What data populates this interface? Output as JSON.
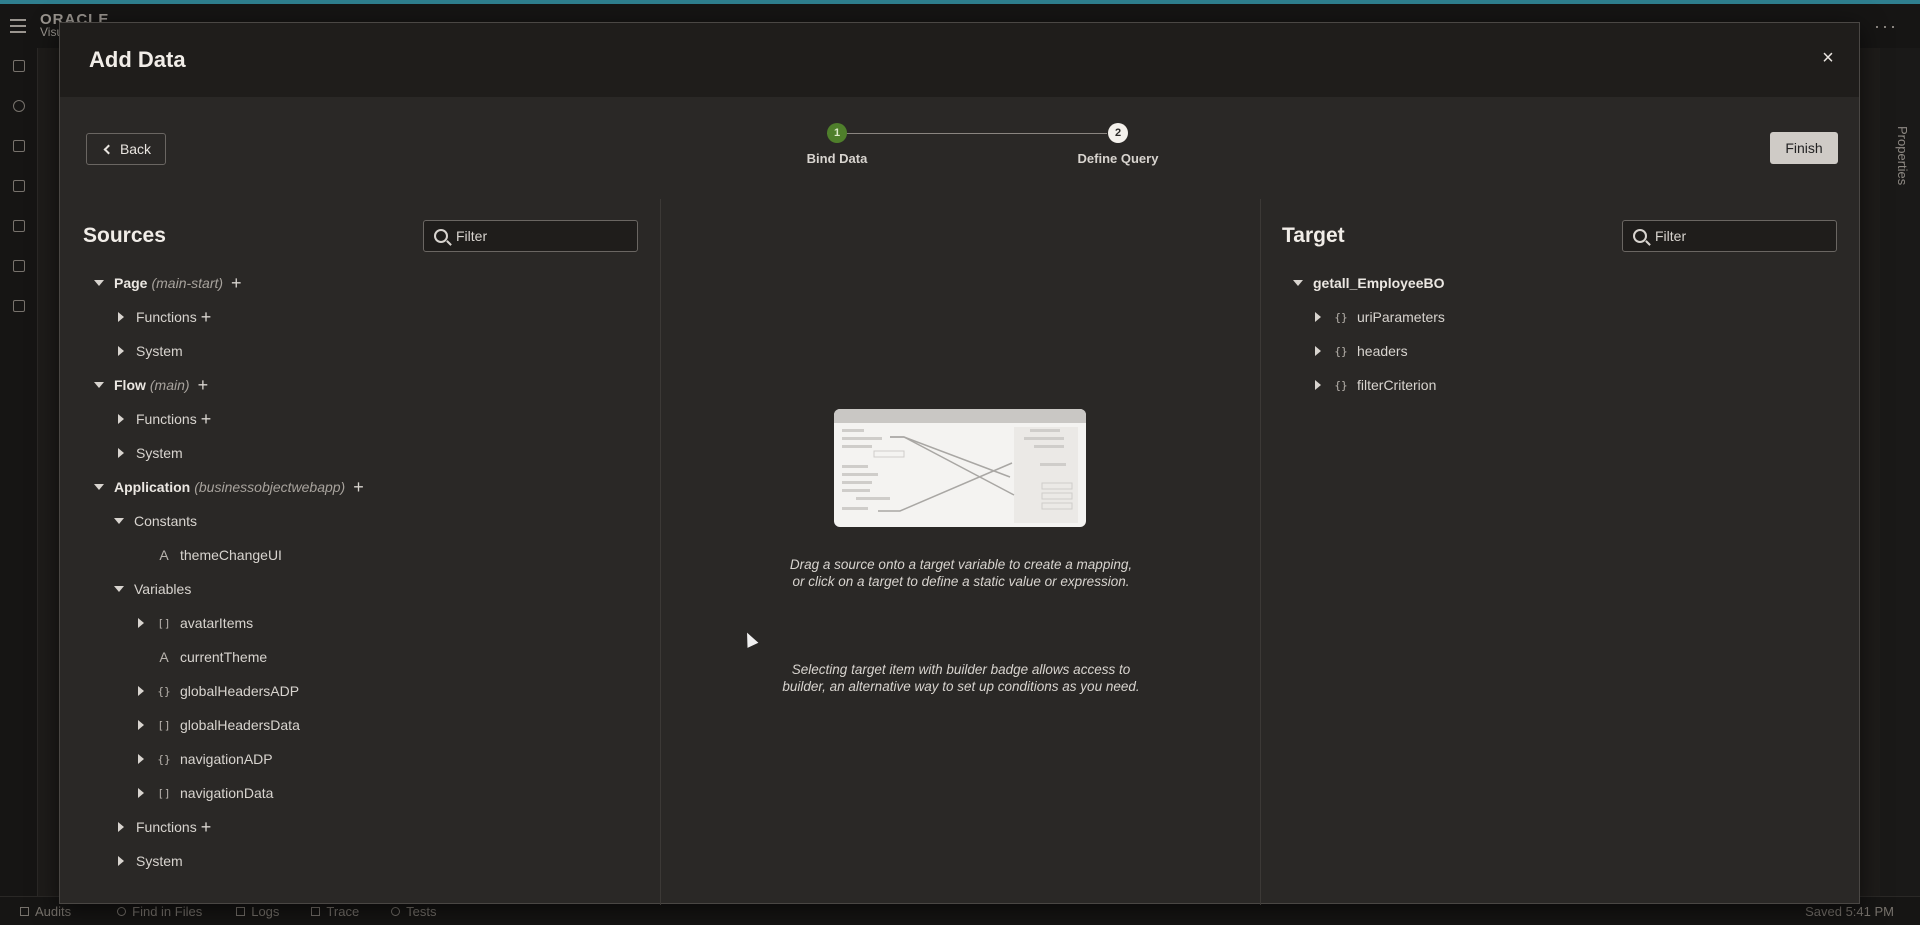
{
  "ide": {
    "logo_line1": "ORACLE",
    "logo_line2": "Visu",
    "bottom": {
      "items": [
        "Audits",
        "Find in Files",
        "Logs",
        "Trace",
        "Tests"
      ],
      "saved": "Saved 5:41 PM"
    },
    "right_tab": "Properties"
  },
  "modal": {
    "title": "Add Data",
    "close_label": "×",
    "back_label": "Back",
    "finish_label": "Finish",
    "steps": [
      {
        "number": "1",
        "label": "Bind Data",
        "state": "done"
      },
      {
        "number": "2",
        "label": "Define Query",
        "state": "todo"
      }
    ],
    "sources": {
      "title": "Sources",
      "filter_placeholder": "Filter",
      "tree": {
        "page": {
          "label": "Page",
          "scope": "(main-start)",
          "functions": "Functions",
          "system": "System"
        },
        "flow": {
          "label": "Flow",
          "scope": "(main)",
          "functions": "Functions",
          "system": "System"
        },
        "application": {
          "label": "Application",
          "scope": "(businessobjectwebapp)",
          "constants": "Constants",
          "constant_items": [
            {
              "type": "A",
              "label": "themeChangeUI"
            }
          ],
          "variables": "Variables",
          "variable_items": [
            {
              "type": "[]",
              "label": "avatarItems",
              "expandable": true
            },
            {
              "type": "A",
              "label": "currentTheme",
              "expandable": false
            },
            {
              "type": "{}",
              "label": "globalHeadersADP",
              "expandable": true
            },
            {
              "type": "[]",
              "label": "globalHeadersData",
              "expandable": true
            },
            {
              "type": "{}",
              "label": "navigationADP",
              "expandable": true
            },
            {
              "type": "[]",
              "label": "navigationData",
              "expandable": true
            }
          ],
          "functions": "Functions",
          "system": "System"
        }
      }
    },
    "center": {
      "hint1": "Drag a source onto a target variable to create a mapping,",
      "hint2": "or click on a target to define a static value or expression.",
      "hint3": "Selecting target item with builder badge allows access to",
      "hint4": "builder, an alternative way to set up conditions as you need."
    },
    "target": {
      "title": "Target",
      "filter_placeholder": "Filter",
      "root": "getall_EmployeeBO",
      "items": [
        {
          "type": "{}",
          "label": "uriParameters"
        },
        {
          "type": "{}",
          "label": "headers"
        },
        {
          "type": "{}",
          "label": "filterCriterion"
        }
      ]
    }
  }
}
